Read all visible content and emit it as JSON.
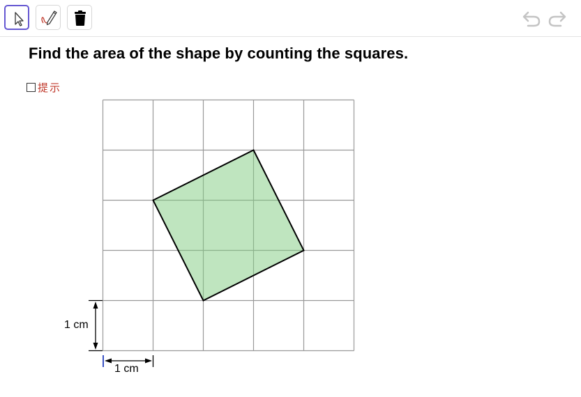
{
  "toolbar": {
    "tools": [
      {
        "name": "move",
        "icon": "cursor-arrow-icon",
        "active": true
      },
      {
        "name": "pen",
        "icon": "pen-icon",
        "active": false
      },
      {
        "name": "delete",
        "icon": "trash-icon",
        "active": false
      }
    ],
    "undo_icon": "undo-icon",
    "redo_icon": "redo-icon"
  },
  "question": "Find the area of the shape by counting the squares.",
  "hint": {
    "label": "提示",
    "checked": false
  },
  "grid": {
    "columns": 5,
    "rows": 5,
    "unit": "1 cm"
  },
  "shape": {
    "vertices_in_grid_units": [
      [
        1,
        2
      ],
      [
        3,
        1
      ],
      [
        4,
        3
      ],
      [
        2,
        4
      ]
    ],
    "fill_color": "#7fcc7f",
    "stroke_color": "#000000"
  },
  "measurements": {
    "vertical_label": "1 cm",
    "horizontal_label": "1 cm"
  },
  "colors": {
    "accent": "#6557d2",
    "hint_text": "#c0392b",
    "grid_line": "#999999"
  }
}
